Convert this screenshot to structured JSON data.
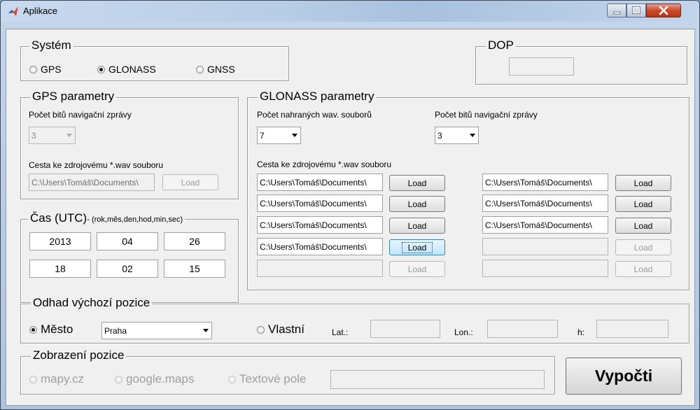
{
  "window": {
    "title": "Aplikace"
  },
  "system": {
    "title": "Systém",
    "options": [
      {
        "label": "GPS",
        "selected": false
      },
      {
        "label": "GLONASS",
        "selected": true
      },
      {
        "label": "GNSS",
        "selected": false
      }
    ]
  },
  "dop": {
    "title": "DOP",
    "value": ""
  },
  "gps": {
    "title": "GPS parametry",
    "bits_label": "Počet bitů navigační zprávy",
    "bits_value": "3",
    "path_label": "Cesta ke zdrojovému *.wav souboru",
    "path_value": "C:\\Users\\Tomáš\\Documents\\",
    "load_label": "Load"
  },
  "time": {
    "title": "Čas (UTC)",
    "subtitle": "- (rok,měs,den,hod,min,sec)",
    "values": [
      "2013",
      "04",
      "26",
      "18",
      "02",
      "15"
    ]
  },
  "glonass": {
    "title": "GLONASS parametry",
    "files_label": "Počet nahraných wav. souborů",
    "files_value": "7",
    "bits_label": "Počet bitů navigační zprávy",
    "bits_value": "3",
    "path_label": "Cesta ke zdrojovému *.wav souboru",
    "load_label": "Load",
    "left_paths": [
      "C:\\Users\\Tomáš\\Documents\\",
      "C:\\Users\\Tomáš\\Documents\\",
      "C:\\Users\\Tomáš\\Documents\\",
      "C:\\Users\\Tomáš\\Documents\\",
      ""
    ],
    "right_paths": [
      "C:\\Users\\Tomáš\\Documents\\",
      "C:\\Users\\Tomáš\\Documents\\",
      "C:\\Users\\Tomáš\\Documents\\",
      "",
      ""
    ]
  },
  "position": {
    "title": "Odhad výchozí pozice",
    "city_label": "Město",
    "city_value": "Praha",
    "own_label": "Vlastní",
    "lat_label": "Lat.:",
    "lon_label": "Lon.:",
    "h_label": "h:"
  },
  "display": {
    "title": "Zobrazení pozice",
    "options": [
      "mapy.cz",
      "google.maps",
      "Textové pole"
    ]
  },
  "compute_label": "Vypočti"
}
